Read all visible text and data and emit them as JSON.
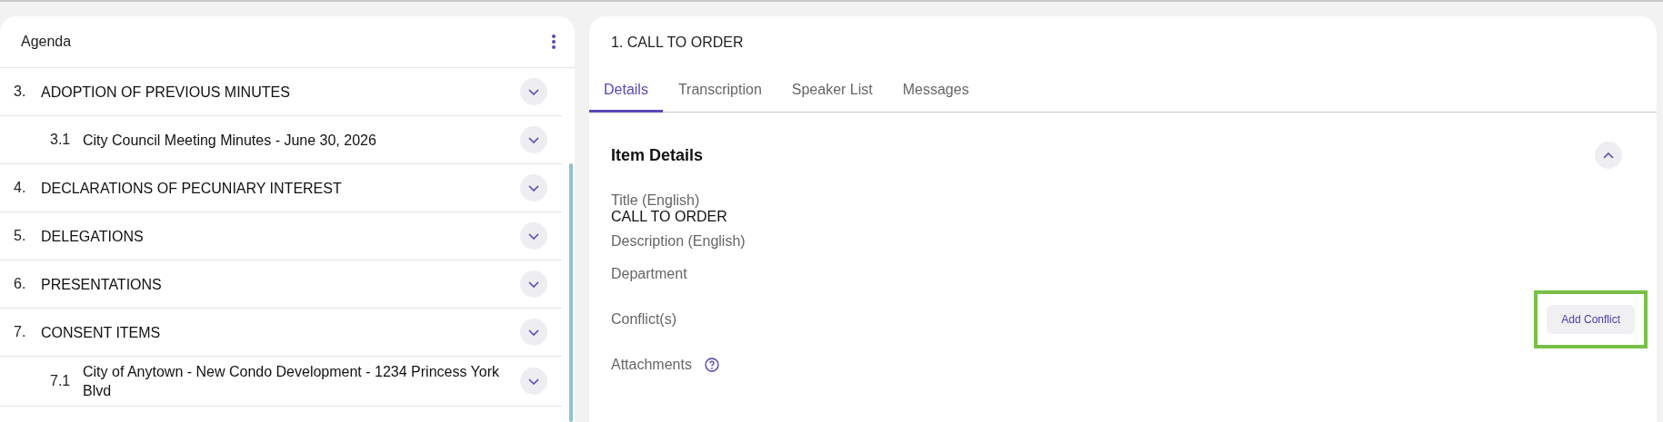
{
  "agenda": {
    "title": "Agenda",
    "items": [
      {
        "number": "3.",
        "label": "ADOPTION OF PREVIOUS MINUTES",
        "expanded": false,
        "children": [
          {
            "number": "3.1",
            "label": "City Council Meeting Minutes - June 30, 2026",
            "expanded": false
          }
        ]
      },
      {
        "number": "4.",
        "label": "DECLARATIONS OF PECUNIARY INTEREST",
        "expanded": false
      },
      {
        "number": "5.",
        "label": "DELEGATIONS",
        "expanded": false
      },
      {
        "number": "6.",
        "label": "PRESENTATIONS",
        "expanded": false
      },
      {
        "number": "7.",
        "label": "CONSENT ITEMS",
        "expanded": false,
        "children": [
          {
            "number": "7.1",
            "label": "City of Anytown - New Condo Development - 1234 Princess York Blvd",
            "expanded": false
          }
        ]
      }
    ]
  },
  "detail": {
    "title": "1. CALL TO ORDER",
    "tabs": [
      {
        "label": "Details",
        "selected": true
      },
      {
        "label": "Transcription",
        "selected": false
      },
      {
        "label": "Speaker List",
        "selected": false
      },
      {
        "label": "Messages",
        "selected": false
      }
    ],
    "section": {
      "title": "Item Details",
      "expanded": true,
      "fields": [
        {
          "label": "Title (English)",
          "value": "CALL TO ORDER"
        },
        {
          "label": "Description (English)"
        },
        {
          "label": "Department"
        },
        {
          "label": "Conflict(s)",
          "action": "Add Conflict",
          "highlighted": true
        },
        {
          "label": "Attachments",
          "help": true
        }
      ]
    }
  }
}
